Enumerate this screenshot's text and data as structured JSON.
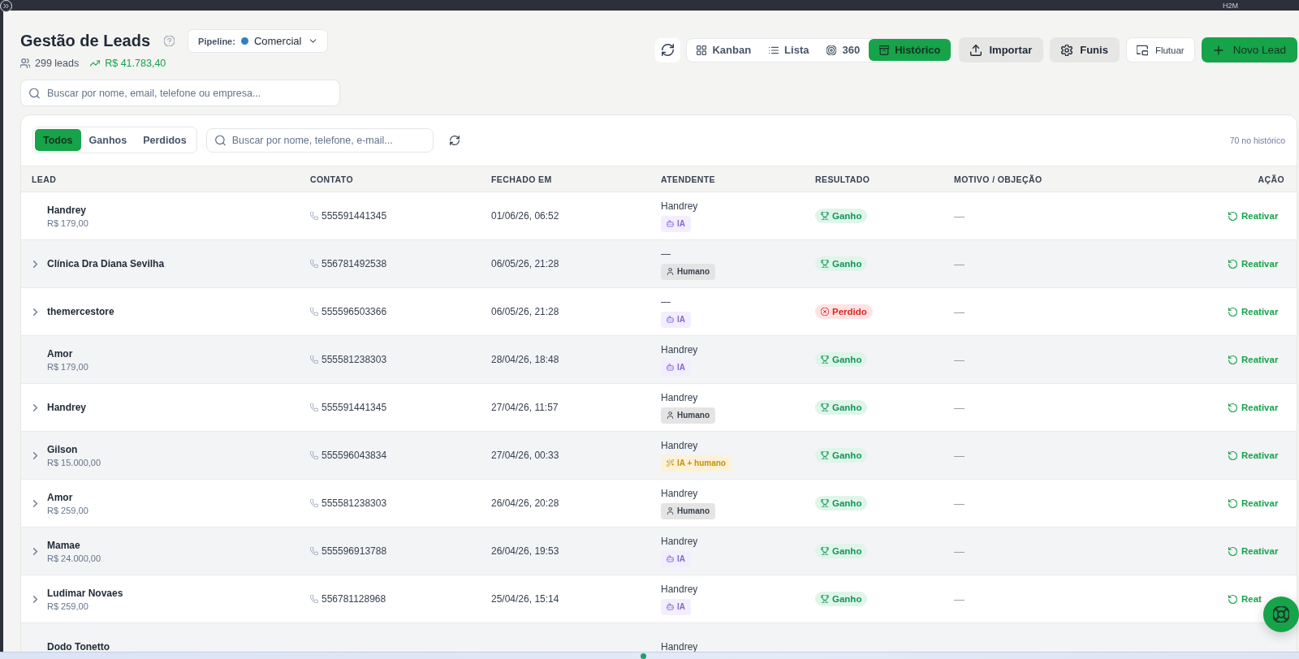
{
  "top_bar": {
    "account_label": "H2M"
  },
  "header": {
    "title": "Gestão de Leads",
    "pipeline": {
      "label": "Pipeline:",
      "value": "Comercial",
      "color": "#2f80c9"
    },
    "lead_count": "299 leads",
    "total_value": "R$ 41.783,40",
    "search": {
      "placeholder": "Buscar por nome, email, telefone ou empresa..."
    }
  },
  "toolbar": {
    "view_switch": [
      {
        "label": "Kanban",
        "selected": false
      },
      {
        "label": "Lista",
        "selected": false
      },
      {
        "label": "360",
        "selected": false
      },
      {
        "label": "Histórico",
        "selected": true
      }
    ],
    "buttons": [
      {
        "label": "Importar",
        "kind": "secondary"
      },
      {
        "label": "Funis",
        "kind": "secondary"
      },
      {
        "label": "Flutuar",
        "kind": "outline"
      },
      {
        "label": "Novo Lead",
        "kind": "primary"
      }
    ]
  },
  "table": {
    "filters": [
      {
        "label": "Todos",
        "selected": true
      },
      {
        "label": "Ganhos",
        "selected": false
      },
      {
        "label": "Perdidos",
        "selected": false
      }
    ],
    "search": {
      "placeholder": "Buscar por nome, telefone, e-mail..."
    },
    "count": "70 no histórico",
    "columns": [
      "LEAD",
      "CONTATO",
      "FECHADO EM",
      "ATENDENTE",
      "RESULTADO",
      "MOTIVO / OBJEÇÃO",
      "AÇÃO"
    ],
    "rows": [
      {
        "lead": "Handrey",
        "value": "R$ 179,00",
        "expandable": false,
        "phone": "555591441345",
        "closed_at": "01/06/26, 06:52",
        "agent": "Handrey",
        "agent_tag": {
          "kind": "ia",
          "label": "IA"
        },
        "result": {
          "kind": "won",
          "label": "Ganho"
        },
        "reason": "—",
        "action": "Reativar"
      },
      {
        "lead": "Clínica Dra Diana Sevilha",
        "expandable": true,
        "phone": "556781492538",
        "closed_at": "06/05/26, 21:28",
        "agent": "—",
        "agent_tag": {
          "kind": "human",
          "label": "Humano"
        },
        "result": {
          "kind": "won",
          "label": "Ganho"
        },
        "reason": "—",
        "action": "Reativar"
      },
      {
        "lead": "themercestore",
        "expandable": true,
        "phone": "555596503366",
        "closed_at": "06/05/26, 21:28",
        "agent": "—",
        "agent_tag": {
          "kind": "ia",
          "label": "IA"
        },
        "result": {
          "kind": "lost",
          "label": "Perdido"
        },
        "reason": "—",
        "action": "Reativar"
      },
      {
        "lead": "Amor",
        "value": "R$ 179,00",
        "expandable": false,
        "phone": "555581238303",
        "closed_at": "28/04/26, 18:48",
        "agent": "Handrey",
        "agent_tag": {
          "kind": "ia",
          "label": "IA"
        },
        "result": {
          "kind": "won",
          "label": "Ganho"
        },
        "reason": "—",
        "action": "Reativar"
      },
      {
        "lead": "Handrey",
        "expandable": true,
        "phone": "555591441345",
        "closed_at": "27/04/26, 11:57",
        "agent": "Handrey",
        "agent_tag": {
          "kind": "human",
          "label": "Humano"
        },
        "result": {
          "kind": "won",
          "label": "Ganho"
        },
        "reason": "—",
        "action": "Reativar"
      },
      {
        "lead": "Gilson",
        "value": "R$ 15.000,00",
        "expandable": true,
        "phone": "555596043834",
        "closed_at": "27/04/26, 00:33",
        "agent": "Handrey",
        "agent_tag": {
          "kind": "hybrid",
          "label": "IA + humano"
        },
        "result": {
          "kind": "won",
          "label": "Ganho"
        },
        "reason": "—",
        "action": "Reativar"
      },
      {
        "lead": "Amor",
        "value": "R$ 259,00",
        "expandable": true,
        "phone": "555581238303",
        "closed_at": "26/04/26, 20:28",
        "agent": "Handrey",
        "agent_tag": {
          "kind": "human",
          "label": "Humano"
        },
        "result": {
          "kind": "won",
          "label": "Ganho"
        },
        "reason": "—",
        "action": "Reativar"
      },
      {
        "lead": "Mamae",
        "value": "R$ 24.000,00",
        "expandable": true,
        "phone": "555596913788",
        "closed_at": "26/04/26, 19:53",
        "agent": "Handrey",
        "agent_tag": {
          "kind": "ia",
          "label": "IA"
        },
        "result": {
          "kind": "won",
          "label": "Ganho"
        },
        "reason": "—",
        "action": "Reativar"
      },
      {
        "lead": "Ludimar Novaes",
        "value": "R$ 259,00",
        "expandable": true,
        "phone": "556781128968",
        "closed_at": "25/04/26, 15:14",
        "agent": "Handrey",
        "agent_tag": {
          "kind": "ia",
          "label": "IA"
        },
        "result": {
          "kind": "won",
          "label": "Ganho"
        },
        "reason": "—",
        "action": "Reat"
      },
      {
        "lead": "Dodo Tonetto",
        "expandable": false,
        "agent": "Handrey"
      }
    ]
  }
}
